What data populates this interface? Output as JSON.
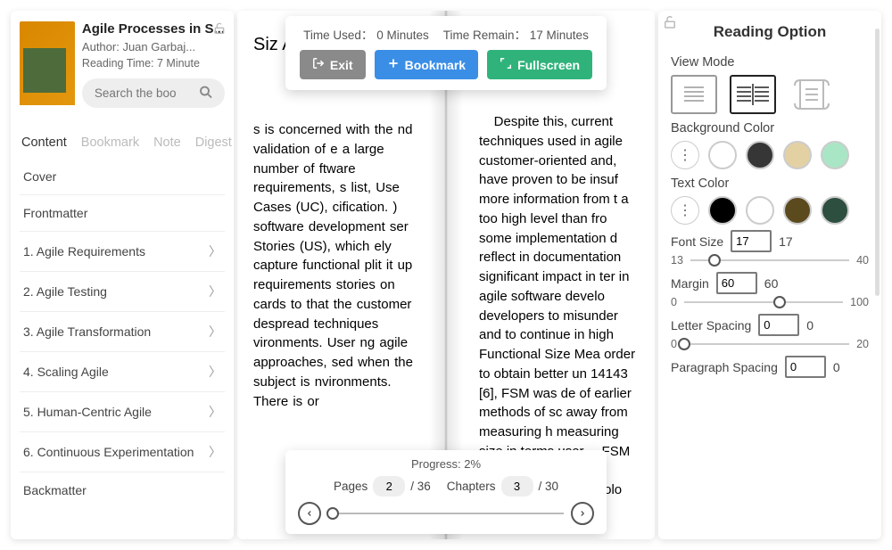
{
  "book": {
    "title": "Agile Processes in S...",
    "author_label": "Author: Juan Garbaj...",
    "reading_time": "Reading Time: 7 Minute"
  },
  "search": {
    "placeholder": "Search the boo"
  },
  "sidebar_tabs": {
    "content": "Content",
    "bookmark": "Bookmark",
    "note": "Note",
    "digest": "Digest"
  },
  "toc": [
    {
      "label": "Cover",
      "expandable": false
    },
    {
      "label": "Frontmatter",
      "expandable": false
    },
    {
      "label": "1. Agile Requirements",
      "expandable": true
    },
    {
      "label": "2. Agile Testing",
      "expandable": true
    },
    {
      "label": "3. Agile Transformation",
      "expandable": true
    },
    {
      "label": "4. Scaling Agile",
      "expandable": true
    },
    {
      "label": "5. Human-Centric Agile",
      "expandable": true
    },
    {
      "label": "6. Continuous Experimentation",
      "expandable": true
    },
    {
      "label": "Backmatter",
      "expandable": false
    }
  ],
  "toolbar": {
    "time_used_label": "Time Used：",
    "time_used_value": "0 Minutes",
    "time_remain_label": "Time Remain：",
    "time_remain_value": "17 Minutes",
    "exit": "Exit",
    "bookmark": "Bookmark",
    "fullscreen": "Fullscreen"
  },
  "page_left_text": "s is concerned with the nd validation of e a large number of ftware requirements, s list, Use Cases (UC), cification. ) software development ser Stories (US), which ely capture functional plit it up requirements stories on cards to that the customer   despread techniques vironments. User ng agile approaches, sed when the subject is nvironments. There is or",
  "page_right_text": "    Despite this, current techniques used in agile customer-oriented and, have proven to be insuf more information from t a too high level than fro some implementation d reflect in documentation significant impact in ter in agile software develo developers to misunder and to continue in high    Functional Size Mea order to obtain better un 14143 [6], FSM was de of earlier methods of sc away from measuring h measuring size in terms user.    FSM intends to mea independent of technolo",
  "page_left_header": "Siz Ag",
  "nav": {
    "progress_label": "Progress: 2%",
    "pages_label": "Pages",
    "pages_current": "2",
    "pages_total": "/ 36",
    "chapters_label": "Chapters",
    "chapters_current": "3",
    "chapters_total": "/ 30"
  },
  "options": {
    "title": "Reading Option",
    "view_mode": "View Mode",
    "bg_color": "Background Color",
    "text_color": "Text Color",
    "font_size_label": "Font Size",
    "font_size_value": "17",
    "font_size_display": "17",
    "font_size_min": "13",
    "font_size_max": "40",
    "margin_label": "Margin",
    "margin_value": "60",
    "margin_display": "60",
    "margin_min": "0",
    "margin_max": "100",
    "letter_label": "Letter Spacing",
    "letter_value": "0",
    "letter_display": "0",
    "letter_min": "0",
    "letter_max": "20",
    "para_label": "Paragraph Spacing",
    "para_value": "0",
    "para_display": "0"
  },
  "colors": {
    "bg": [
      "#ffffff",
      "#363636",
      "#e3d1a4",
      "#a9e6c6"
    ],
    "text": [
      "#000000",
      "#ffffff",
      "#5c4a1f",
      "#2d4f3f"
    ]
  }
}
